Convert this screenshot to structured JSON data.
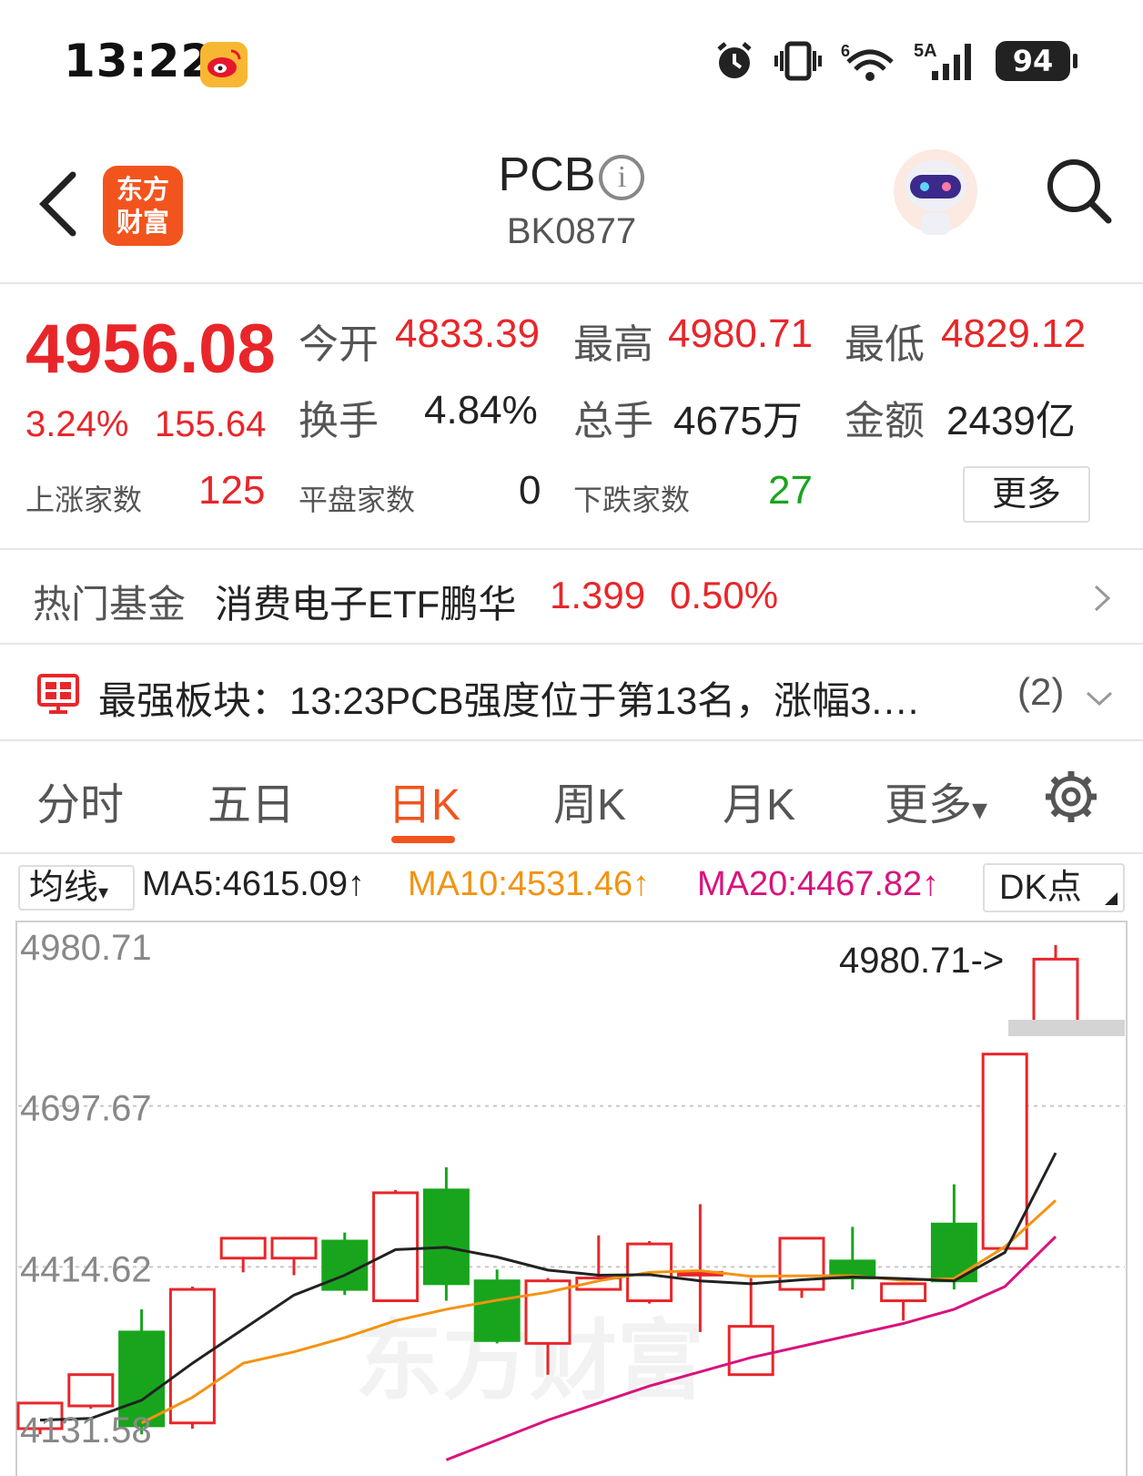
{
  "status_bar": {
    "time": "13:22",
    "network": "5A",
    "wifi_label": "6",
    "battery": "94",
    "icons": [
      "weibo-app-icon",
      "alarm-icon",
      "vibrate-icon",
      "wifi-icon",
      "signal-icon",
      "battery-icon"
    ]
  },
  "header": {
    "logo_line1": "东方",
    "logo_line2": "财富",
    "title": "PCB",
    "info_glyph": "i",
    "code": "BK0877"
  },
  "quote": {
    "price": "4956.08",
    "change_pct": "3.24%",
    "change_amt": "155.64",
    "open_label": "今开",
    "open": "4833.39",
    "high_label": "最高",
    "high": "4980.71",
    "low_label": "最低",
    "low": "4829.12",
    "turnover_label": "换手",
    "turnover": "4.84%",
    "volume_label": "总手",
    "volume": "4675万",
    "amount_label": "金额",
    "amount": "2439亿",
    "up_label": "上涨家数",
    "up_count": "125",
    "flat_label": "平盘家数",
    "flat_count": "0",
    "down_label": "下跌家数",
    "down_count": "27",
    "more": "更多"
  },
  "fund": {
    "label": "热门基金",
    "name": "消费电子ETF鹏华",
    "value": "1.399",
    "pct": "0.50%"
  },
  "sector": {
    "text": "最强板块：13:23PCB强度位于第13名，涨幅3.…",
    "count": "(2)"
  },
  "tabs": [
    "分时",
    "五日",
    "日K",
    "周K",
    "月K",
    "更多"
  ],
  "tab_more_arrow": "▾",
  "active_tab": "日K",
  "ma": {
    "selector": "均线",
    "ma5": "MA5:4615.09↑",
    "ma10": "MA10:4531.46↑",
    "ma20": "MA20:4467.82↑",
    "dk": "DK点"
  },
  "colors": {
    "up": "#e8262a",
    "down": "#18a51d",
    "brand": "#f2541d",
    "ma5": "#222222",
    "ma10": "#f39312",
    "ma20": "#d8137d"
  },
  "chart_data": {
    "type": "candlestick",
    "y_labels": [
      "4980.71",
      "4697.67",
      "4414.62",
      "4131.58"
    ],
    "high_marker": "4980.71->",
    "watermark": "东方财富",
    "candles": [
      {
        "o": 4130,
        "c": 4175,
        "h": 4175,
        "l": 4120
      },
      {
        "o": 4170,
        "c": 4225,
        "h": 4225,
        "l": 4165
      },
      {
        "o": 4300,
        "c": 4135,
        "h": 4340,
        "l": 4120
      },
      {
        "o": 4140,
        "c": 4375,
        "h": 4380,
        "l": 4130
      },
      {
        "o": 4430,
        "c": 4465,
        "h": 4465,
        "l": 4405
      },
      {
        "o": 4430,
        "c": 4465,
        "h": 4465,
        "l": 4400
      },
      {
        "o": 4460,
        "c": 4375,
        "h": 4475,
        "l": 4365
      },
      {
        "o": 4355,
        "c": 4545,
        "h": 4550,
        "l": 4355
      },
      {
        "o": 4550,
        "c": 4385,
        "h": 4590,
        "l": 4355
      },
      {
        "o": 4390,
        "c": 4285,
        "h": 4410,
        "l": 4280
      },
      {
        "o": 4280,
        "c": 4390,
        "h": 4395,
        "l": 4225
      },
      {
        "o": 4375,
        "c": 4395,
        "h": 4470,
        "l": 4375
      },
      {
        "o": 4355,
        "c": 4455,
        "h": 4460,
        "l": 4350
      },
      {
        "o": 4405,
        "c": 4405,
        "h": 4525,
        "l": 4300
      },
      {
        "o": 4225,
        "c": 4310,
        "h": 4395,
        "l": 4225
      },
      {
        "o": 4375,
        "c": 4465,
        "h": 4465,
        "l": 4360
      },
      {
        "o": 4425,
        "c": 4395,
        "h": 4485,
        "l": 4375
      },
      {
        "o": 4355,
        "c": 4385,
        "h": 4385,
        "l": 4320
      },
      {
        "o": 4490,
        "c": 4390,
        "h": 4560,
        "l": 4375
      },
      {
        "o": 4447,
        "c": 4789,
        "h": 4789,
        "l": 4447
      },
      {
        "o": 4833.39,
        "c": 4956.08,
        "h": 4980.71,
        "l": 4829.12
      }
    ],
    "ma5": [
      4145,
      4148,
      4180,
      4245,
      4305,
      4365,
      4400,
      4445,
      4449,
      4432,
      4409,
      4400,
      4401,
      4390,
      4385,
      4392,
      4397,
      4394,
      4390,
      4440,
      4615.09
    ],
    "ma10": [
      null,
      null,
      4140,
      4185,
      4245,
      4265,
      4290,
      4320,
      4340,
      4356,
      4370,
      4390,
      4405,
      4408,
      4398,
      4399,
      4399,
      4391,
      4394,
      4450,
      4531.46
    ],
    "ma20": [
      null,
      null,
      null,
      null,
      null,
      null,
      null,
      null,
      4075,
      4110,
      4145,
      4175,
      4205,
      4230,
      4255,
      4275,
      4295,
      4315,
      4340,
      4380,
      4467.82
    ]
  }
}
